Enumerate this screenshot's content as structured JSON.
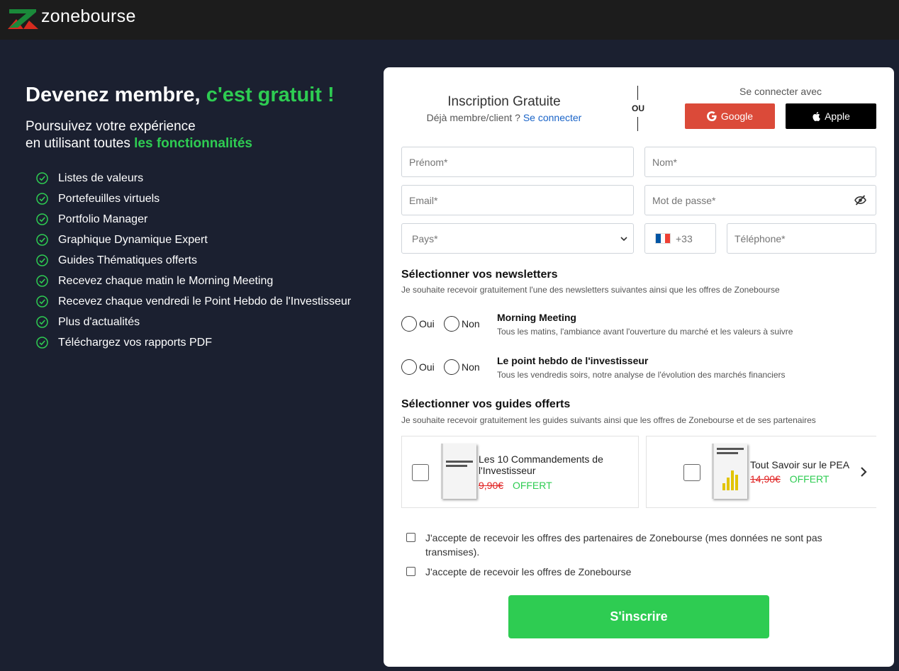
{
  "brand": {
    "name": "zonebourse",
    "accent": "#2ecc52"
  },
  "hero": {
    "headline_main": "Devenez membre,",
    "headline_accent": "c'est gratuit !",
    "sub_line1": "Poursuivez votre expérience",
    "sub_line2_prefix": "en utilisant toutes",
    "sub_line2_accent": "les fonctionnalités",
    "features": [
      "Listes de valeurs",
      "Portefeuilles virtuels",
      "Portfolio Manager",
      "Graphique Dynamique Expert",
      "Guides Thématiques offerts",
      "Recevez chaque matin le Morning Meeting",
      "Recevez chaque vendredi le Point Hebdo de l'Investisseur",
      "Plus d'actualités",
      "Téléchargez vos rapports PDF"
    ]
  },
  "form": {
    "title": "Inscription Gratuite",
    "already_member": "Déjà membre/client ?",
    "login_link": "Se connecter",
    "or_label": "OU",
    "connect_with": "Se connecter avec",
    "google_label": "Google",
    "apple_label": "Apple",
    "fields": {
      "first_name": "Prénom*",
      "last_name": "Nom*",
      "email": "Email*",
      "password": "Mot de passe*",
      "country": "Pays*",
      "phone_prefix": "+33",
      "phone": "Téléphone*"
    },
    "newsletters": {
      "title": "Sélectionner vos newsletters",
      "subtitle": "Je souhaite recevoir gratuitement l'une des newsletters suivantes ainsi que les offres de Zonebourse",
      "yes_label": "Oui",
      "no_label": "Non",
      "items": [
        {
          "name": "Morning Meeting",
          "desc": "Tous les matins, l'ambiance avant l'ouverture du marché et les valeurs à suivre"
        },
        {
          "name": "Le point hebdo de l'investisseur",
          "desc": "Tous les vendredis soirs, notre analyse de l'évolution des marchés financiers"
        }
      ]
    },
    "guides": {
      "title": "Sélectionner vos guides offerts",
      "subtitle": "Je souhaite recevoir gratuitement les guides suivants ainsi que les offres de Zonebourse et de ses partenaires",
      "free_label": "OFFERT",
      "items": [
        {
          "title_line1": "Les 10 Commandements de",
          "title_line2": "l'Investisseur",
          "old_price": "9,90€"
        },
        {
          "title_line1": "Tout Savoir sur le PEA",
          "title_line2": "",
          "old_price": "14,90€"
        }
      ]
    },
    "consents": {
      "partners": "J'accepte de recevoir les offres des partenaires de Zonebourse (mes données ne sont pas transmises).",
      "zonebourse": "J'accepte de recevoir les offres de Zonebourse"
    },
    "submit_label": "S'inscrire"
  }
}
